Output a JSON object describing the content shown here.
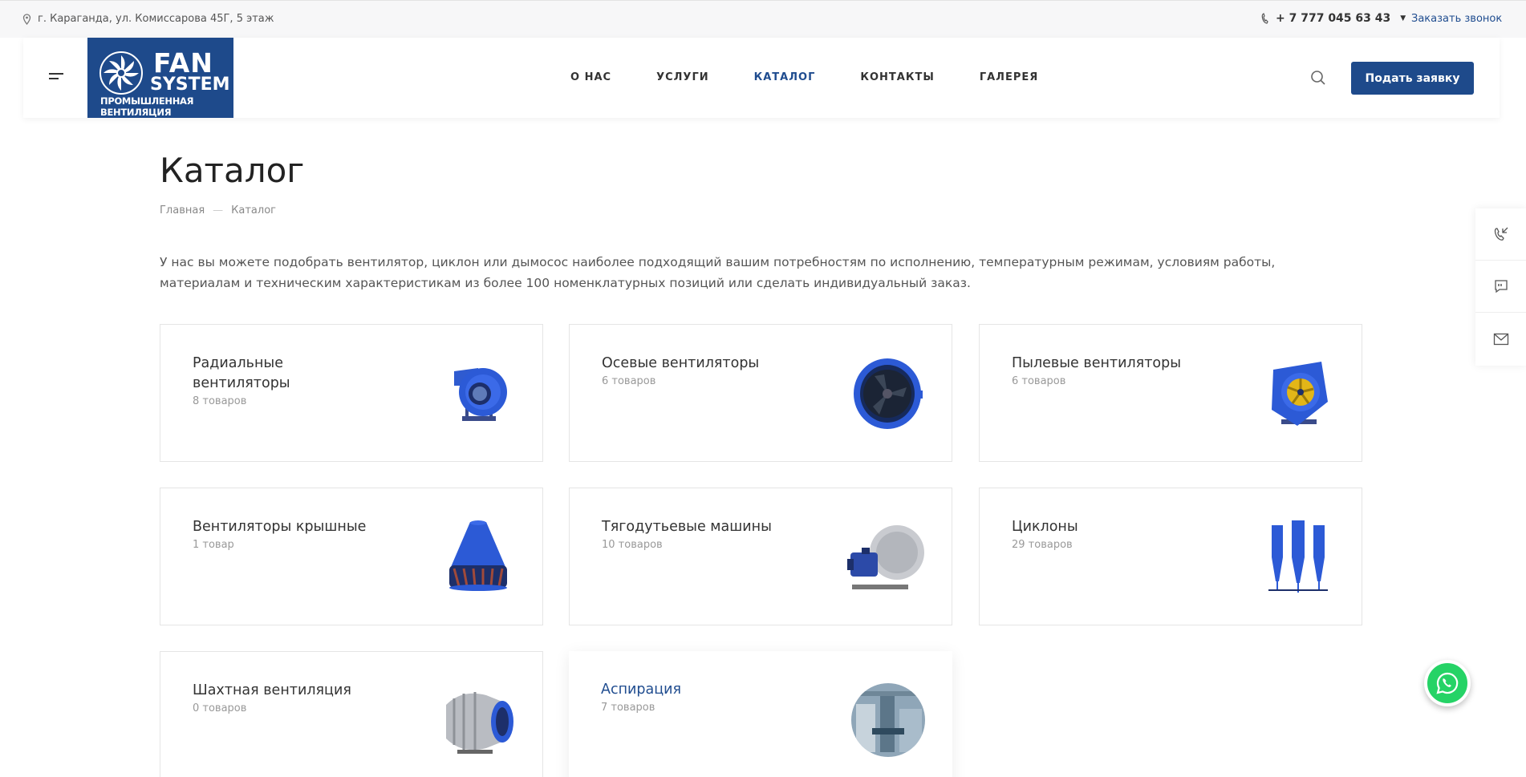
{
  "topbar": {
    "address": "г. Караганда, ул. Комиссарова 45Г, 5 этаж",
    "phone": "+ 7 777 045 63 43",
    "callback_label": "Заказать звонок"
  },
  "logo": {
    "line1": "FAN",
    "line2": "SYSTEM",
    "line3": "ПРОМЫШЛЕННАЯ ВЕНТИЛЯЦИЯ"
  },
  "nav": {
    "items": [
      {
        "label": "О НАС"
      },
      {
        "label": "УСЛУГИ"
      },
      {
        "label": "КАТАЛОГ"
      },
      {
        "label": "КОНТАКТЫ"
      },
      {
        "label": "ГАЛЕРЕЯ"
      }
    ],
    "active_index": 2
  },
  "header": {
    "apply_button": "Подать заявку"
  },
  "page": {
    "title": "Каталог",
    "breadcrumb": [
      "Главная",
      "Каталог"
    ],
    "intro": "У нас вы можете подобрать вентилятор, циклон или дымосос наиболее подходящий вашим потребностям по исполнению, температурным режимам, условиям работы, материалам и техническим характеристикам из более 100 номенклатурных позиций или сделать индивидуальный заказ."
  },
  "catalog": {
    "cards": [
      {
        "name": "Радиальные вентиляторы",
        "count": "8 товаров",
        "icon": "radial-fan-icon"
      },
      {
        "name": "Осевые вентиляторы",
        "count": "6 товаров",
        "icon": "axial-fan-icon"
      },
      {
        "name": "Пылевые вентиляторы",
        "count": "6 товаров",
        "icon": "dust-fan-icon"
      },
      {
        "name": "Вентиляторы крышные",
        "count": "1 товар",
        "icon": "roof-fan-icon"
      },
      {
        "name": "Тягодутьевые машины",
        "count": "10 товаров",
        "icon": "draft-machine-icon"
      },
      {
        "name": "Циклоны",
        "count": "29 товаров",
        "icon": "cyclone-icon"
      },
      {
        "name": "Шахтная вентиляция",
        "count": "0 товаров",
        "icon": "mine-fan-icon"
      },
      {
        "name": "Аспирация",
        "count": "7 товаров",
        "icon": "aspiration-icon"
      }
    ]
  },
  "colors": {
    "brand": "#1e4a8b",
    "link": "#1f4c8f",
    "whatsapp": "#25d366",
    "fan_blue": "#2c5ad6"
  }
}
